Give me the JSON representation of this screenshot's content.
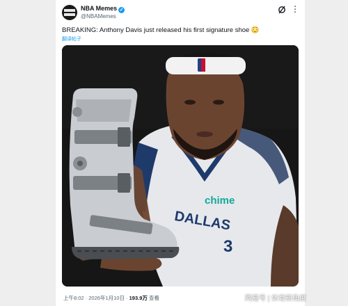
{
  "account": {
    "name": "NBA Memes",
    "handle": "@NBAMemes",
    "avatar_text": "NBA MEMES",
    "verified_icon": "verified-badge-icon",
    "verified_color": "#1d9bf0"
  },
  "toolbar": {
    "grok_icon": "grok-icon",
    "more_icon": "more-options-icon"
  },
  "tweet": {
    "text": "BREAKING: Anthony Davis just released his first signature shoe 😳",
    "translate_label": "翻译帖子"
  },
  "media": {
    "jersey_brand": "chime",
    "jersey_text": "DALLAS",
    "jersey_number": "3"
  },
  "footer": {
    "time": "上午8:02 · 2026年1月10日 · ",
    "views_count": "193.9万",
    "views_label": " 查看"
  },
  "watermark": "网易号 | 体育新角度",
  "colors": {
    "accent": "#1d9bf0",
    "text": "#0f1419",
    "secondary_text": "#536471"
  }
}
